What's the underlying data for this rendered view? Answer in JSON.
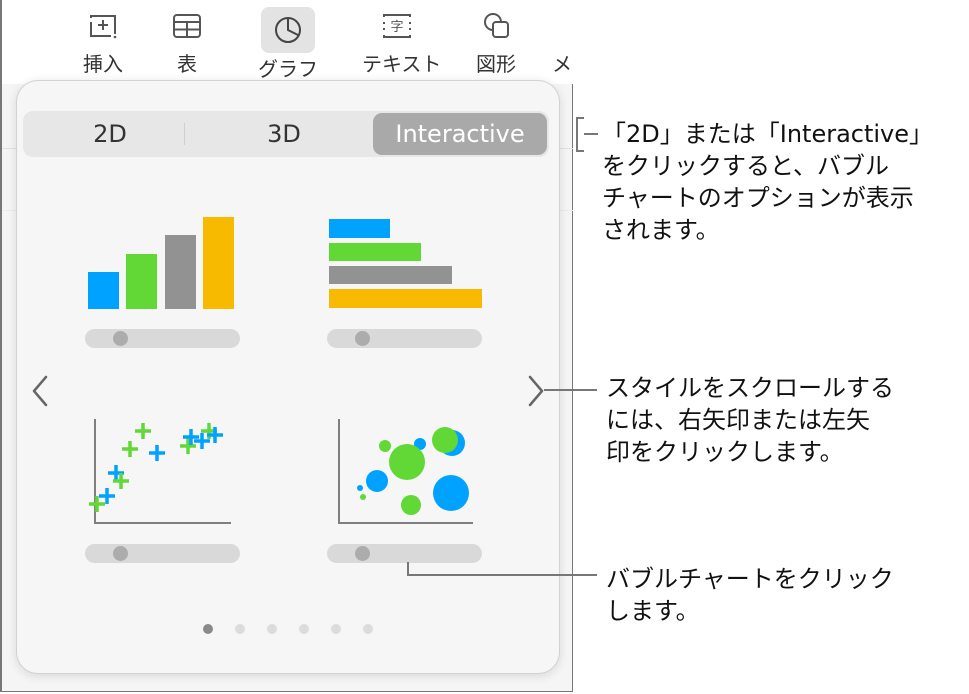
{
  "toolbar": {
    "items": [
      {
        "label": "挿入",
        "icon": "insert-icon"
      },
      {
        "label": "表",
        "icon": "table-icon"
      },
      {
        "label": "グラフ",
        "icon": "chart-pie-icon",
        "active": true
      },
      {
        "label": "テキスト",
        "icon": "text-box-icon"
      },
      {
        "label": "図形",
        "icon": "shape-icon"
      },
      {
        "label": "メ",
        "icon": "media-icon"
      }
    ]
  },
  "popover": {
    "tabs": [
      {
        "label": "2D"
      },
      {
        "label": "3D"
      },
      {
        "label": "Interactive",
        "active": true
      }
    ],
    "chart_styles": [
      {
        "name": "column-chart",
        "slider_value": 0.2
      },
      {
        "name": "bar-chart",
        "slider_value": 0.2
      },
      {
        "name": "scatter-chart",
        "slider_value": 0.2
      },
      {
        "name": "bubble-chart",
        "slider_value": 0.2
      }
    ],
    "colors": {
      "blue": "#00a2ff",
      "green": "#61d836",
      "gray": "#929292",
      "yellow": "#f8ba00"
    },
    "page_indicator": {
      "total": 6,
      "current": 1
    }
  },
  "callouts": {
    "tabs_note": "「2D」または「Interactive」をクリックすると、バブルチャートのオプションが表示されます。",
    "tabs_note_lines": [
      "「2D」または「Interactive」",
      "をクリックすると、バブル",
      "チャートのオプションが表示",
      "されます。"
    ],
    "scroll_note_lines": [
      "スタイルをスクロールする",
      "には、右矢印または左矢",
      "印をクリックします。"
    ],
    "bubble_note_lines": [
      "バブルチャートをクリック",
      "します。"
    ]
  }
}
